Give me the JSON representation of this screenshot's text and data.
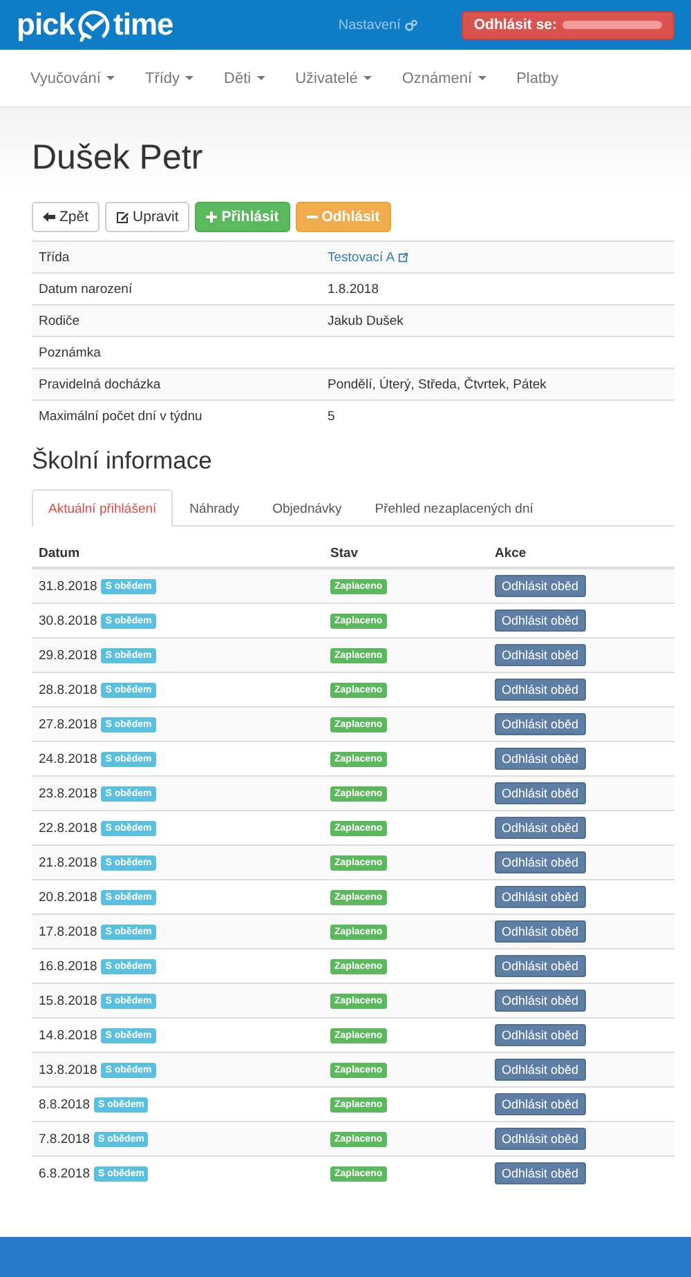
{
  "header": {
    "logo_left": "pick",
    "logo_right": "time",
    "settings": "Nastavení",
    "logout": "Odhlásit se:"
  },
  "nav": [
    {
      "label": "Vyučování",
      "dropdown": true
    },
    {
      "label": "Třídy",
      "dropdown": true
    },
    {
      "label": "Děti",
      "dropdown": true
    },
    {
      "label": "Uživatelé",
      "dropdown": true
    },
    {
      "label": "Oznámení",
      "dropdown": true
    },
    {
      "label": "Platby",
      "dropdown": false
    }
  ],
  "title": "Dušek Petr",
  "actions": [
    {
      "kind": "back",
      "label": "Zpět"
    },
    {
      "kind": "edit",
      "label": "Upravit"
    },
    {
      "kind": "add",
      "label": "Přihlásit"
    },
    {
      "kind": "remove",
      "label": "Odhlásit"
    }
  ],
  "details": [
    {
      "label": "Třída",
      "value": "Testovací A",
      "link": true
    },
    {
      "label": "Datum narození",
      "value": "1.8.2018",
      "link": false
    },
    {
      "label": "Rodiče",
      "value": "Jakub Dušek",
      "link": false
    },
    {
      "label": "Poznámka"
    },
    {
      "label": "Pravidelná docházka",
      "value": "Pondělí, Úterý, Středa, Čtvrtek, Pátek",
      "link": false
    },
    {
      "label": "Maximální počet dní v týdnu",
      "value": "5",
      "link": false
    }
  ],
  "section_title": "Školní informace",
  "tabs": [
    {
      "label": "Aktuální přihlášení",
      "selected": true
    },
    {
      "label": "Náhrady",
      "selected": false
    },
    {
      "label": "Objednávky",
      "selected": false
    },
    {
      "label": "Přehled nezaplacených dní",
      "selected": false
    }
  ],
  "table": {
    "columns": [
      "Datum",
      "Stav",
      "Akce"
    ],
    "rows": [
      {
        "date": "31.8.2018",
        "tag": "S obědem",
        "status": "Zaplaceno",
        "action": "Odhlásit oběd"
      },
      {
        "date": "30.8.2018",
        "tag": "S obědem",
        "status": "Zaplaceno",
        "action": "Odhlásit oběd"
      },
      {
        "date": "29.8.2018",
        "tag": "S obědem",
        "status": "Zaplaceno",
        "action": "Odhlásit oběd"
      },
      {
        "date": "28.8.2018",
        "tag": "S obědem",
        "status": "Zaplaceno",
        "action": "Odhlásit oběd"
      },
      {
        "date": "27.8.2018",
        "tag": "S obědem",
        "status": "Zaplaceno",
        "action": "Odhlásit oběd"
      },
      {
        "date": "24.8.2018",
        "tag": "S obědem",
        "status": "Zaplaceno",
        "action": "Odhlásit oběd"
      },
      {
        "date": "23.8.2018",
        "tag": "S obědem",
        "status": "Zaplaceno",
        "action": "Odhlásit oběd"
      },
      {
        "date": "22.8.2018",
        "tag": "S obědem",
        "status": "Zaplaceno",
        "action": "Odhlásit oběd"
      },
      {
        "date": "21.8.2018",
        "tag": "S obědem",
        "status": "Zaplaceno",
        "action": "Odhlásit oběd"
      },
      {
        "date": "20.8.2018",
        "tag": "S obědem",
        "status": "Zaplaceno",
        "action": "Odhlásit oběd"
      },
      {
        "date": "17.8.2018",
        "tag": "S obědem",
        "status": "Zaplaceno",
        "action": "Odhlásit oběd"
      },
      {
        "date": "16.8.2018",
        "tag": "S obědem",
        "status": "Zaplaceno",
        "action": "Odhlásit oběd"
      },
      {
        "date": "15.8.2018",
        "tag": "S obědem",
        "status": "Zaplaceno",
        "action": "Odhlásit oběd"
      },
      {
        "date": "14.8.2018",
        "tag": "S obědem",
        "status": "Zaplaceno",
        "action": "Odhlásit oběd"
      },
      {
        "date": "13.8.2018",
        "tag": "S obědem",
        "status": "Zaplaceno",
        "action": "Odhlásit oběd"
      },
      {
        "date": "8.8.2018",
        "tag": "S obědem",
        "status": "Zaplaceno",
        "action": "Odhlásit oběd"
      },
      {
        "date": "7.8.2018",
        "tag": "S obědem",
        "status": "Zaplaceno",
        "action": "Odhlásit oběd"
      },
      {
        "date": "6.8.2018",
        "tag": "S obědem",
        "status": "Zaplaceno",
        "action": "Odhlásit oběd"
      }
    ]
  }
}
